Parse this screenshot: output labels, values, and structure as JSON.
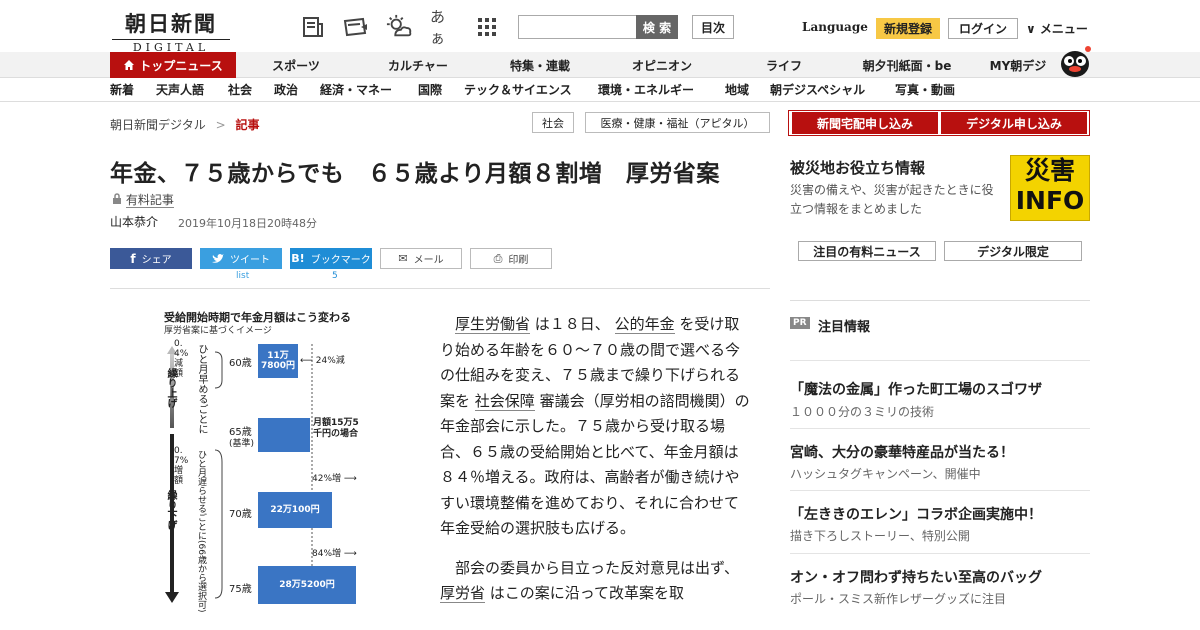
{
  "header": {
    "logo_jp": "朝日新聞",
    "logo_en": "DIGITAL",
    "search_button": "検 索",
    "toc_button": "目次",
    "language": "Language",
    "register": "新規登録",
    "login": "ログイン",
    "menu": "∨ メニュー",
    "font_size_icon_text": "あぁ"
  },
  "nav_primary": [
    "トップニュース",
    "スポーツ",
    "カルチャー",
    "特集・連載",
    "オピニオン",
    "ライフ",
    "朝夕刊紙面・be",
    "MY朝デジ"
  ],
  "nav_secondary": [
    "新着",
    "天声人語",
    "社会",
    "政治",
    "経済・マネー",
    "国際",
    "テック＆サイエンス",
    "環境・エネルギー",
    "地域",
    "朝デジスペシャル",
    "写真・動画"
  ],
  "breadcrumb": {
    "home": "朝日新聞デジタル",
    "separator": ">",
    "current": "記事"
  },
  "tags": [
    "社会",
    "医療・健康・福祉（アピタル）"
  ],
  "article": {
    "title": "年金、７５歳からでも　６５歳より月額８割増　厚労省案",
    "paid_label": "有料記事",
    "author": "山本恭介",
    "date": "2019年10月18日20時48分",
    "share": {
      "facebook": "シェア",
      "twitter": "ツイート",
      "twitter_sub": "list",
      "hatena": "ブックマーク",
      "hatena_count": "5",
      "mail": "メール",
      "print": "印刷"
    },
    "p1": {
      "a": "厚生労働省",
      "b": "は１８日、",
      "c": "公的年金",
      "d": "を受け取り始める年齢を６０～７０歳の間で選べる今の仕組みを変え、７５歳まで繰り下げられる案を",
      "e": "社会保障",
      "f": "審議会（厚労相の諮問機関）の年金部会に示した。７５歳から受け取る場合、６５歳の受給開始と比べて、年金月額は８４％増える。政府は、高齢者が働き続けやすい環境整備を進めており、それに合わせて年金受給の選択肢も広げる。"
    },
    "p2": {
      "a": "部会の委員から目立った反対意見は出ず、",
      "b": "厚労省",
      "c": "はこの案に沿って改革案を取"
    }
  },
  "infographic": {
    "title": "受給開始時期で年金月額はこう変わる",
    "subtitle": "厚労省案に基づくイメージ",
    "up_label": "繰り上げ",
    "down_label": "繰り下げ",
    "up_rate": "0.4%減額",
    "up_rule": "ひと月早めるごとに",
    "down_rate": "0.7%増額",
    "down_rule": "ひと月遅らせるごとに(66歳から選択可)",
    "rows": [
      {
        "age": "60歳",
        "amount": "11万7800円",
        "change": "24%減",
        "amount_yen": 117800
      },
      {
        "age": "65歳",
        "age_note": "(基準)",
        "amount": "月額15万5千円の場合",
        "amount_yen": 155000
      },
      {
        "age": "70歳",
        "amount": "22万100円",
        "change": "42%増",
        "amount_yen": 220100
      },
      {
        "age": "75歳",
        "amount": "28万5200円",
        "change": "84%増",
        "amount_yen": 285200
      }
    ]
  },
  "sidebar": {
    "btn_newspaper": "新聞宅配申し込み",
    "btn_digital": "デジタル申し込み",
    "disaster_title": "被災地お役立ち情報",
    "disaster_desc": "災害の備えや、災害が起きたときに役立つ情報をまとめました",
    "disaster_img_top": "災害",
    "disaster_img_bottom": "INFO",
    "btn_paid_news": "注目の有料ニュース",
    "btn_digital_only": "デジタル限定",
    "pr_badge": "PR",
    "pr_title": "注目情報",
    "pr_items": [
      {
        "title": "「魔法の金属」作った町工場のスゴワザ",
        "sub": "１０００分の３ミリの技術"
      },
      {
        "title": "宮崎、大分の豪華特産品が当たる！",
        "sub": "ハッシュタグキャンペーン、開催中"
      },
      {
        "title": "「左ききのエレン」コラボ企画実施中！",
        "sub": "描き下ろしストーリー、特別公開"
      },
      {
        "title": "オン・オフ問わず持ちたい至高のバッグ",
        "sub": "ポール・スミス新作レザーグッズに注目"
      }
    ]
  },
  "colors": {
    "brand_red": "#b8100f",
    "accent_yellow": "#f7c845",
    "chart_blue": "#3a75c4"
  }
}
